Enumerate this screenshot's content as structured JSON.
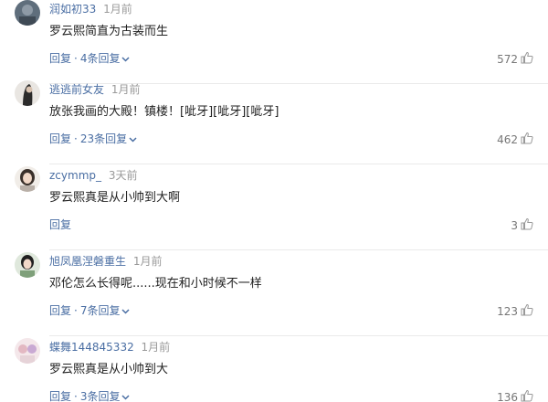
{
  "comments": [
    {
      "username": "润如初33",
      "time": "1月前",
      "content": "罗云熙简直为古装而生",
      "reply_label": "回复",
      "replies_label": "4条回复",
      "likes": "572"
    },
    {
      "username": "逃逃前女友",
      "time": "1月前",
      "content": "放张我画的大殿！镇楼！[呲牙][呲牙][呲牙]",
      "reply_label": "回复",
      "replies_label": "23条回复",
      "likes": "462"
    },
    {
      "username": "zcymmp_",
      "time": "3天前",
      "content": "罗云熙真是从小帅到大啊",
      "reply_label": "回复",
      "replies_label": "",
      "likes": "3"
    },
    {
      "username": "旭凤凰涅磐重生",
      "time": "1月前",
      "content": "邓伦怎么长得呢......现在和小时候不一样",
      "reply_label": "回复",
      "replies_label": "7条回复",
      "likes": "123"
    },
    {
      "username": "蝶舞144845332",
      "time": "1月前",
      "content": "罗云熙真是从小帅到大",
      "reply_label": "回复",
      "replies_label": "3条回复",
      "likes": "136"
    }
  ],
  "icons": {
    "like": "thumbs-up-icon",
    "expand": "chevron-down-icon"
  },
  "colors": {
    "username": "#4a6ea3",
    "link": "#4a6ea3",
    "meta": "#999999",
    "text": "#222222"
  }
}
